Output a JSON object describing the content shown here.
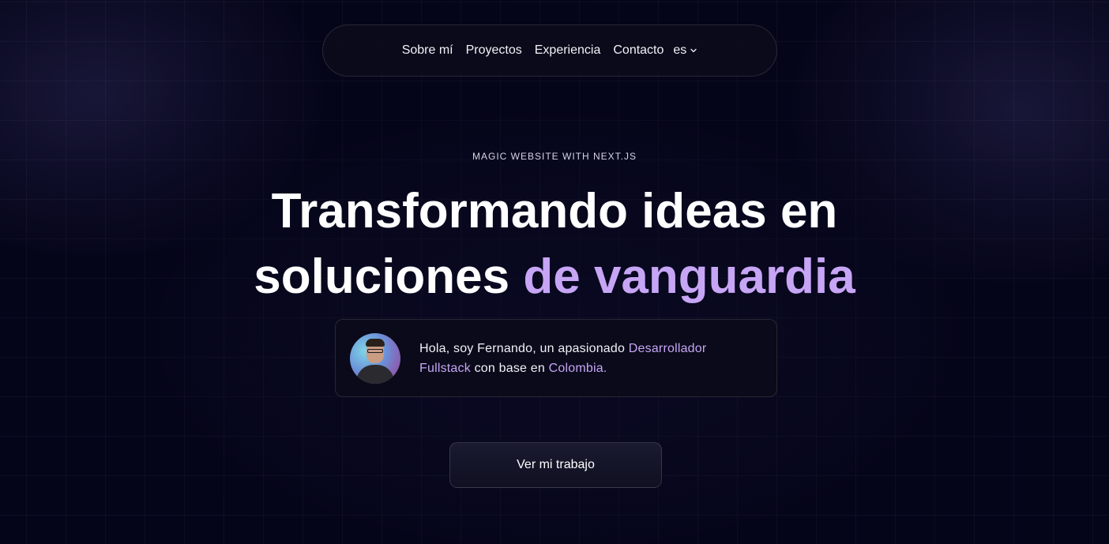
{
  "nav": {
    "items": [
      {
        "label": "Sobre mí"
      },
      {
        "label": "Proyectos"
      },
      {
        "label": "Experiencia"
      },
      {
        "label": "Contacto"
      }
    ],
    "language": "es"
  },
  "hero": {
    "eyebrow": "MAGIC WEBSITE WITH NEXT.JS",
    "headline_line1": "Transformando ideas en",
    "headline_line2_plain": "soluciones ",
    "headline_line2_accent": "de vanguardia",
    "accent_color": "#c7a5f5"
  },
  "intro": {
    "text_before": "Hola, soy Fernando, un apasionado ",
    "highlight_role": "Desarrollador Fullstack",
    "text_middle": " con base en ",
    "highlight_location": "Colombia."
  },
  "cta": {
    "label": "Ver mi trabajo"
  }
}
